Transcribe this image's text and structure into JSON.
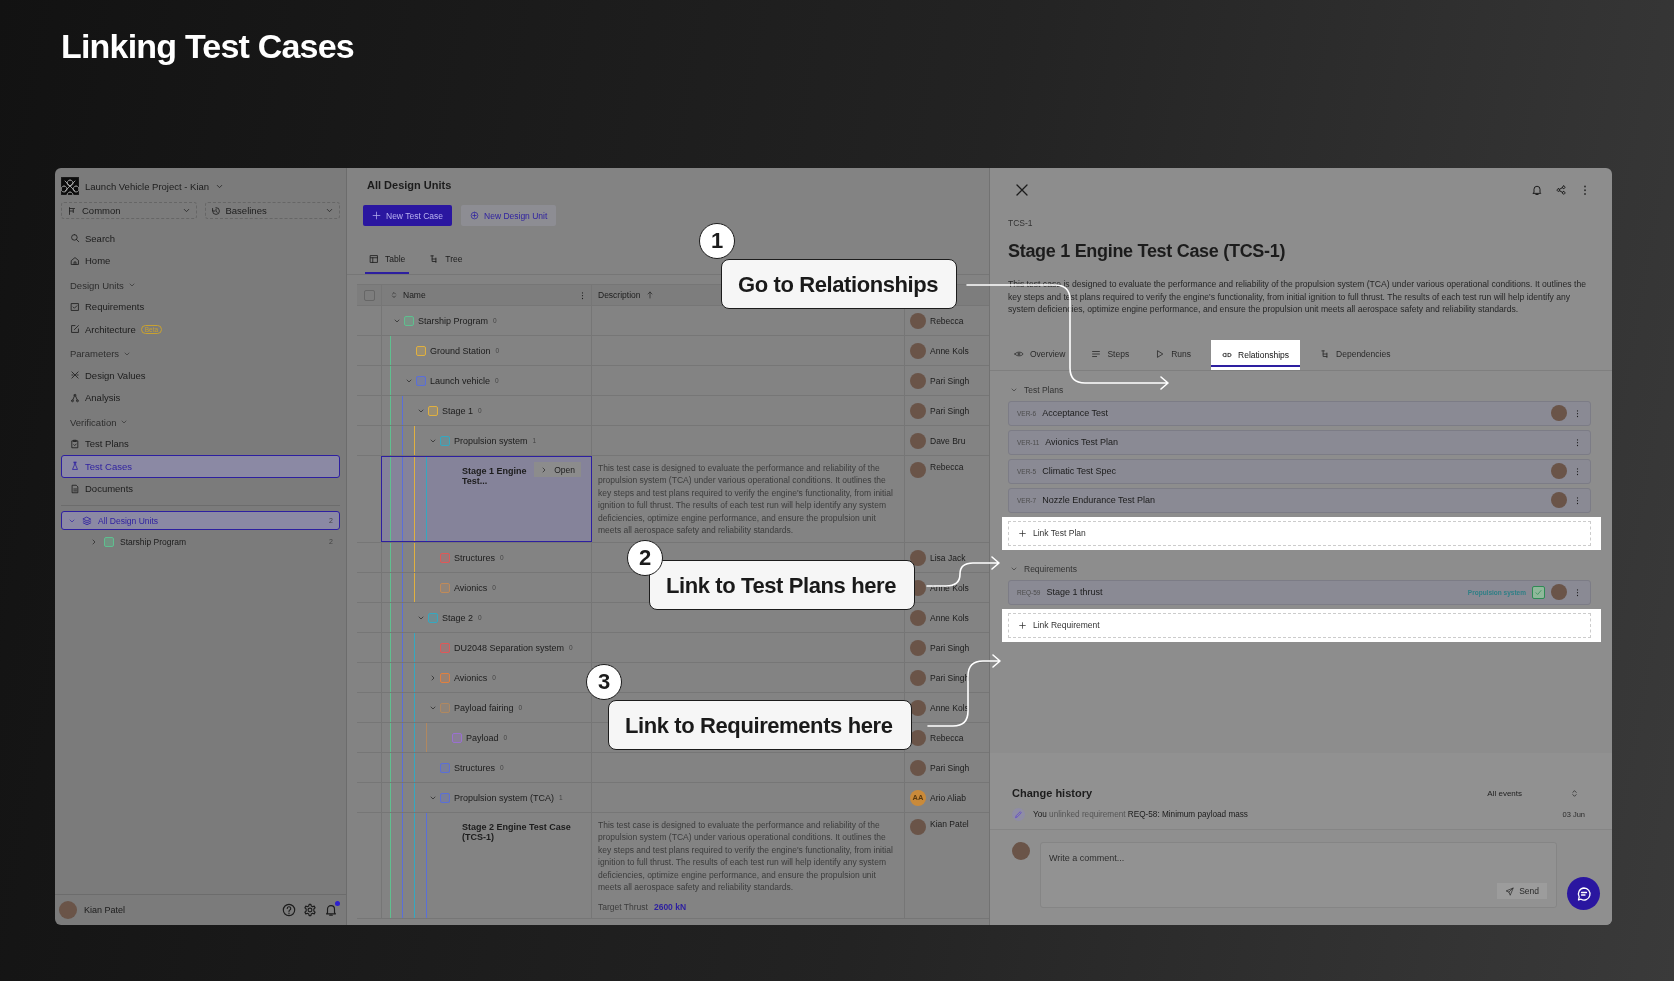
{
  "page_title": "Linking Test Cases",
  "sidebar": {
    "project": "Launch Vehicle Project - Kian",
    "branch": "Common",
    "baseline": "Baselines",
    "nav": [
      {
        "kind": "item",
        "label": "Search",
        "selected": false
      },
      {
        "kind": "item",
        "label": "Home",
        "selected": false
      },
      {
        "kind": "section",
        "label": "Design Units",
        "expanded": true
      },
      {
        "kind": "item",
        "label": "Requirements",
        "selected": false
      },
      {
        "kind": "item",
        "label": "Architecture",
        "badge": "Beta",
        "selected": false
      },
      {
        "kind": "section",
        "label": "Parameters",
        "expanded": true
      },
      {
        "kind": "item",
        "label": "Design Values",
        "selected": false
      },
      {
        "kind": "item",
        "label": "Analysis",
        "selected": false
      },
      {
        "kind": "section",
        "label": "Verification",
        "expanded": true
      },
      {
        "kind": "item",
        "label": "Test Plans",
        "selected": false
      },
      {
        "kind": "item",
        "label": "Test Cases",
        "selected": true
      },
      {
        "kind": "item",
        "label": "Documents",
        "selected": false
      }
    ],
    "tree": [
      {
        "label": "All Design Units",
        "count": "2",
        "selected": true,
        "expanded": true,
        "children": [
          {
            "label": "Starship Program",
            "count": "2",
            "color": "#5fbf8f",
            "selected": false,
            "expanded": false
          }
        ]
      }
    ],
    "user": "Kian Patel",
    "unread": true
  },
  "main": {
    "title": "All Design Units",
    "buttons": [
      {
        "label": "New Test Case",
        "kind": "primary"
      },
      {
        "label": "New Design Unit",
        "kind": "secondary"
      }
    ],
    "view_tabs": [
      {
        "label": "Table",
        "selected": true
      },
      {
        "label": "Tree",
        "selected": false
      }
    ],
    "table": {
      "columns": [
        "Name",
        "Description"
      ],
      "select_all_checked": false,
      "rows": [
        {
          "kind": "unit",
          "name": "Starship Program",
          "count": "0",
          "color": "#5fbf8f",
          "expanded": true,
          "owner": "Rebecca",
          "children": [
            {
              "kind": "unit",
              "name": "Ground Station",
              "count": "0",
              "color": "#e0b040",
              "owner": "Anne Kols"
            },
            {
              "kind": "unit",
              "name": "Launch vehicle",
              "count": "0",
              "color": "#5a6fd8",
              "expanded": true,
              "owner": "Pari Singh",
              "children": [
                {
                  "kind": "unit",
                  "name": "Stage 1",
                  "count": "0",
                  "color": "#e0b040",
                  "expanded": true,
                  "owner": "Pari Singh",
                  "children": [
                    {
                      "kind": "unit",
                      "name": "Propulsion system",
                      "count": "1",
                      "color": "#35a8c0",
                      "expanded": true,
                      "owner": "Dave Bru",
                      "children": [
                        {
                          "kind": "test_case",
                          "name": "Stage 1 Engine Test...",
                          "action": "Open",
                          "selected": true,
                          "owner": "Rebecca",
                          "description": "This test case is designed to evaluate the performance and reliability of the propulsion system (TCA) under various operational conditions. It outlines the key steps and test plans required to verify the engine's functionality, from initial ignition to full thrust. The results of each test run will help identify any system deficiencies, optimize engine performance, and ensure the propulsion unit meets all aerospace safety and reliability standards."
                        }
                      ]
                    },
                    {
                      "kind": "unit",
                      "name": "Structures",
                      "count": "0",
                      "color": "#e05858",
                      "owner": "Lisa Jack"
                    },
                    {
                      "kind": "unit",
                      "name": "Avionics",
                      "count": "0",
                      "color": "#c08a5a",
                      "owner": "Anne Kols"
                    }
                  ]
                },
                {
                  "kind": "unit",
                  "name": "Stage 2",
                  "count": "0",
                  "color": "#35a8c0",
                  "expanded": true,
                  "owner": "Anne Kols",
                  "children": [
                    {
                      "kind": "unit",
                      "name": "DU2048 Separation system",
                      "count": "0",
                      "color": "#e05858",
                      "owner": "Pari Singh"
                    },
                    {
                      "kind": "unit",
                      "name": "Avionics",
                      "count": "0",
                      "color": "#e08040",
                      "expanded": false,
                      "owner": "Pari Singh"
                    },
                    {
                      "kind": "unit",
                      "name": "Payload fairing",
                      "count": "0",
                      "color": "#b08860",
                      "expanded": true,
                      "owner": "Anne Kols",
                      "children": [
                        {
                          "kind": "unit",
                          "name": "Payload",
                          "count": "0",
                          "color": "#9a70d0",
                          "owner": "Rebecca"
                        }
                      ]
                    },
                    {
                      "kind": "unit",
                      "name": "Structures",
                      "count": "0",
                      "color": "#5a6fd8",
                      "owner": "Pari Singh"
                    },
                    {
                      "kind": "unit",
                      "name": "Propulsion system (TCA)",
                      "count": "1",
                      "color": "#5a6fd8",
                      "expanded": true,
                      "owner": "Ario Aliab",
                      "owner_initials": "AA",
                      "children": [
                        {
                          "kind": "test_case",
                          "name": "Stage 2 Engine Test Case (TCS-1)",
                          "selected": false,
                          "owner": "Kian Patel",
                          "description": "This test case is designed to evaluate the performance and reliability of the propulsion system (TCA) under various operational conditions. It outlines the key steps and test plans required to verify the engine's functionality, from initial ignition to full thrust. The results of each test run will help identify any system deficiencies, optimize engine performance, and ensure the propulsion unit meets all aerospace safety and reliability standards.",
                          "field_label": "Target Thrust",
                          "field_value": "2600 kN"
                        }
                      ]
                    }
                  ]
                }
              ]
            }
          ]
        }
      ]
    }
  },
  "detail": {
    "id": "TCS-1",
    "title": "Stage 1 Engine Test Case (TCS-1)",
    "description": "This test case is designed to evaluate the performance and reliability of the propulsion system (TCA) under various operational conditions. It outlines the key steps and test plans required to verify the engine's functionality, from initial ignition to full thrust. The results of each test run will help identify any system deficiencies, optimize engine performance, and ensure the propulsion unit meets all aerospace safety and reliability standards.",
    "tabs": [
      {
        "label": "Overview",
        "selected": false
      },
      {
        "label": "Steps",
        "selected": false
      },
      {
        "label": "Runs",
        "selected": false
      },
      {
        "label": "Relationships",
        "selected": true
      },
      {
        "label": "Dependencies",
        "selected": false
      }
    ],
    "sections": [
      {
        "label": "Test Plans",
        "expanded": true,
        "link_action": "Link Test Plan",
        "items": [
          {
            "id": "VER-6",
            "name": "Acceptance Test",
            "has_avatar": true
          },
          {
            "id": "VER-11",
            "name": "Avionics Test Plan",
            "has_avatar": false
          },
          {
            "id": "VER-5",
            "name": "Climatic Test Spec",
            "has_avatar": true
          },
          {
            "id": "VER-7",
            "name": "Nozzle Endurance Test Plan",
            "has_avatar": true
          }
        ]
      },
      {
        "label": "Requirements",
        "expanded": true,
        "link_action": "Link Requirement",
        "items": [
          {
            "id": "REQ-59",
            "name": "Stage 1 thrust",
            "tag": "Propulsion system",
            "checked": true,
            "has_avatar": true
          }
        ]
      }
    ],
    "history": {
      "title": "Change history",
      "filter": "All events",
      "entries": [
        {
          "text": "**You** unlinked requirement **REQ-58: Minimum payload mass**",
          "date": "03 Jun"
        }
      ]
    },
    "comment": {
      "placeholder": "Write a comment...",
      "send": "Send"
    }
  },
  "annotations": [
    {
      "number": "1",
      "text": "Go to Relationships"
    },
    {
      "number": "2",
      "text": "Link to Test Plans here"
    },
    {
      "number": "3",
      "text": "Link to Requirements here"
    }
  ]
}
